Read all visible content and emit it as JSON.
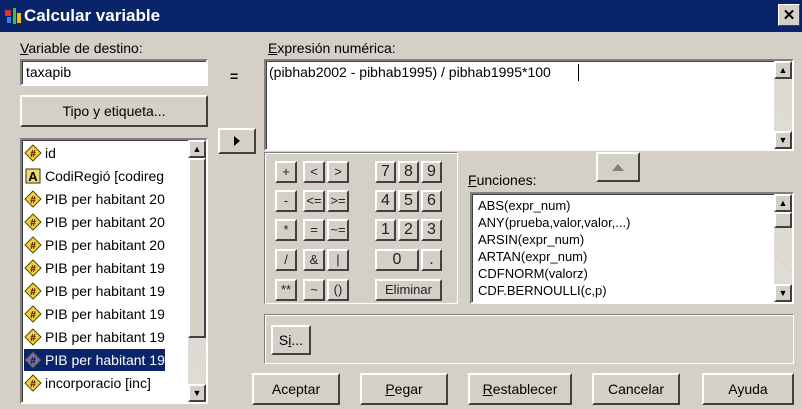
{
  "window": {
    "title": "Calcular variable",
    "close_glyph": "✕"
  },
  "target": {
    "label_u": "V",
    "label_rest": "ariable de destino:",
    "value": "taxapib",
    "equals": "=",
    "type_button": "Tipo y etiqueta..."
  },
  "expression": {
    "label_u": "E",
    "label_rest": "xpresión numérica:",
    "value": "(pibhab2002 - pibhab1995) / pibhab1995*100"
  },
  "variables": [
    {
      "label": "id",
      "icon": "numeric-variable-icon",
      "selected": false
    },
    {
      "label": "CodiRegió [codireg",
      "icon": "string-variable-icon",
      "selected": false
    },
    {
      "label": "PIB per habitant 20",
      "icon": "numeric-variable-icon",
      "selected": false
    },
    {
      "label": "PIB per habitant 20",
      "icon": "numeric-variable-icon",
      "selected": false
    },
    {
      "label": "PIB per habitant 20",
      "icon": "numeric-variable-icon",
      "selected": false
    },
    {
      "label": "PIB per habitant 19",
      "icon": "numeric-variable-icon",
      "selected": false
    },
    {
      "label": "PIB per habitant 19",
      "icon": "numeric-variable-icon",
      "selected": false
    },
    {
      "label": "PIB per habitant 19",
      "icon": "numeric-variable-icon",
      "selected": false
    },
    {
      "label": "PIB per habitant 19",
      "icon": "numeric-variable-icon",
      "selected": false
    },
    {
      "label": "PIB per habitant 19",
      "icon": "numeric-variable-icon",
      "selected": true
    },
    {
      "label": "incorporacio [inc]",
      "icon": "numeric-variable-icon",
      "selected": false
    }
  ],
  "keypad": {
    "row1": [
      "+",
      "<",
      ">",
      "7",
      "8",
      "9"
    ],
    "row2": [
      "-",
      "<=",
      ">=",
      "4",
      "5",
      "6"
    ],
    "row3": [
      "*",
      "=",
      "~=",
      "1",
      "2",
      "3"
    ],
    "row4": [
      "/",
      "&",
      "|",
      "0",
      "."
    ],
    "row5": [
      "**",
      "~",
      "()"
    ],
    "delete": "Eliminar"
  },
  "functions": {
    "label_u": "F",
    "label_rest": "unciones:",
    "items": [
      "ABS(expr_num)",
      "ANY(prueba,valor,valor,...)",
      "ARSIN(expr_num)",
      "ARTAN(expr_num)",
      "CDFNORM(valorz)",
      "CDF.BERNOULLI(c,p)"
    ]
  },
  "if_button": {
    "label_pre": "S",
    "label_u": "i",
    "label_post": "..."
  },
  "buttons": {
    "accept": "Aceptar",
    "paste_u": "P",
    "paste_rest": "egar",
    "reset_u": "R",
    "reset_rest": "establecer",
    "cancel": "Cancelar",
    "help": "Ayuda"
  },
  "colors": {
    "titlebar": "#0a246a",
    "face": "#d4d0c8",
    "selection": "#0a246a"
  }
}
